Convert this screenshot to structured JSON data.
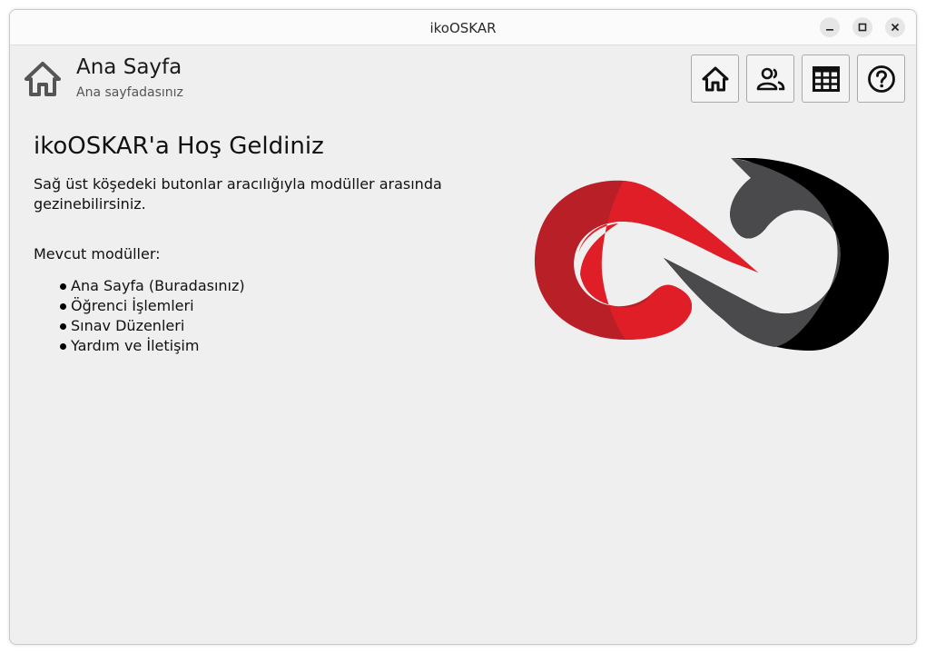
{
  "window": {
    "title": "ikoOSKAR",
    "controls": [
      "minimize-icon",
      "maximize-icon",
      "close-icon"
    ]
  },
  "header": {
    "icon": "home-icon",
    "title": "Ana Sayfa",
    "subtitle": "Ana sayfadasınız"
  },
  "nav": [
    {
      "name": "home",
      "icon": "home-icon"
    },
    {
      "name": "students",
      "icon": "users-icon"
    },
    {
      "name": "exams",
      "icon": "grid-icon"
    },
    {
      "name": "help",
      "icon": "help-icon"
    }
  ],
  "main": {
    "welcome": "ikoOSKAR'a Hoş Geldiniz",
    "description": "Sağ üst köşedeki butonlar aracılığıyla modüller arasında gezinebilirsiniz.",
    "modules_title": "Mevcut modüller:",
    "modules": [
      "Ana Sayfa (Buradasınız)",
      "Öğrenci İşlemleri",
      "Sınav Düzenleri",
      "Yardım ve İletişim"
    ]
  },
  "colors": {
    "accent_red": "#e01e28",
    "dark_red": "#b81f27",
    "dark_gray": "#4a4a4c",
    "black": "#000000",
    "background": "#efefef"
  }
}
